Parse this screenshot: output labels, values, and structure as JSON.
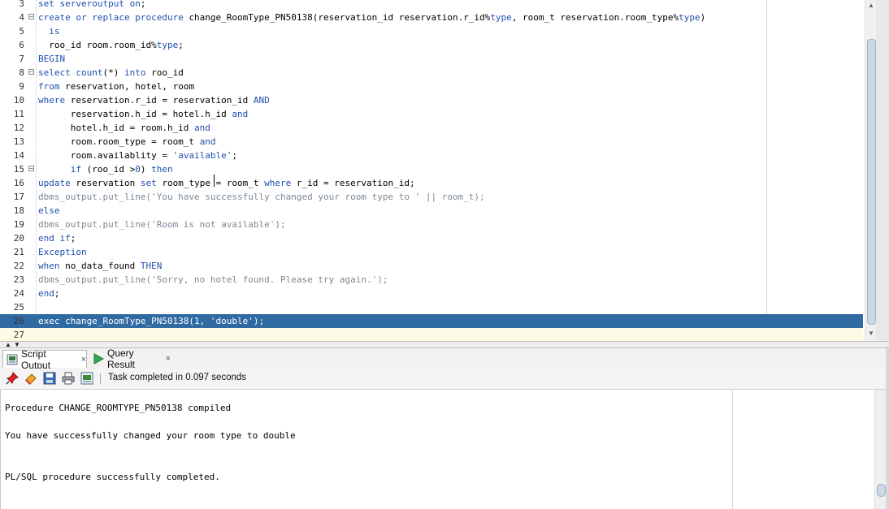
{
  "editor": {
    "lines": [
      {
        "n": "3",
        "fold": false,
        "tokens": [
          [
            "kw",
            "set serveroutput on"
          ],
          [
            "",
            "; "
          ]
        ]
      },
      {
        "n": "4",
        "fold": true,
        "tokens": [
          [
            "kw",
            "create or replace procedure "
          ],
          [
            "",
            "change_RoomType_PN50138(reservation_id reservation.r_id%"
          ],
          [
            "kw",
            "type"
          ],
          [
            "",
            ", room_t reservation.room_type%"
          ],
          [
            "kw",
            "type"
          ],
          [
            "",
            ")"
          ]
        ]
      },
      {
        "n": "5",
        "fold": false,
        "tokens": [
          [
            "kw",
            "  is"
          ]
        ]
      },
      {
        "n": "6",
        "fold": false,
        "tokens": [
          [
            "",
            "  roo_id room.room_id%"
          ],
          [
            "kw",
            "type"
          ],
          [
            "",
            ";"
          ]
        ]
      },
      {
        "n": "7",
        "fold": false,
        "tokens": [
          [
            "kw",
            "BEGIN"
          ]
        ]
      },
      {
        "n": "8",
        "fold": true,
        "tokens": [
          [
            "kw",
            "select "
          ],
          [
            "kw",
            "count"
          ],
          [
            "",
            "(*) "
          ],
          [
            "kw",
            "into"
          ],
          [
            "",
            " roo_id"
          ]
        ]
      },
      {
        "n": "9",
        "fold": false,
        "tokens": [
          [
            "kw",
            "from"
          ],
          [
            "",
            " reservation, hotel, room"
          ]
        ]
      },
      {
        "n": "10",
        "fold": false,
        "tokens": [
          [
            "kw",
            "where"
          ],
          [
            "",
            " reservation.r_id = reservation_id "
          ],
          [
            "kw",
            "AND"
          ]
        ]
      },
      {
        "n": "11",
        "fold": false,
        "tokens": [
          [
            "",
            "      reservation.h_id = hotel.h_id "
          ],
          [
            "kw",
            "and"
          ]
        ]
      },
      {
        "n": "12",
        "fold": false,
        "tokens": [
          [
            "",
            "      hotel.h_id = room.h_id "
          ],
          [
            "kw",
            "and"
          ]
        ]
      },
      {
        "n": "13",
        "fold": false,
        "tokens": [
          [
            "",
            "      room.room_type = room_t "
          ],
          [
            "kw",
            "and"
          ]
        ]
      },
      {
        "n": "14",
        "fold": false,
        "tokens": [
          [
            "",
            "      room.availablity = "
          ],
          [
            "str",
            "'available'"
          ],
          [
            "",
            ";"
          ]
        ]
      },
      {
        "n": "15",
        "fold": true,
        "tokens": [
          [
            "",
            "      "
          ],
          [
            "kw",
            "if"
          ],
          [
            "",
            " (roo_id >"
          ],
          [
            "str",
            "0"
          ],
          [
            "",
            ") "
          ],
          [
            "kw",
            "then"
          ]
        ]
      },
      {
        "n": "16",
        "fold": false,
        "tokens": [
          [
            "kw",
            "update"
          ],
          [
            "",
            " reservation "
          ],
          [
            "kw",
            "set"
          ],
          [
            "",
            " room_type = room_t "
          ],
          [
            "kw",
            "where"
          ],
          [
            "",
            " r_id = reservation_id;"
          ]
        ]
      },
      {
        "n": "17",
        "fold": false,
        "tokens": [
          [
            "cm",
            "dbms_output.put_line('You have successfully changed your room type to ' || room_t);"
          ]
        ]
      },
      {
        "n": "18",
        "fold": false,
        "tokens": [
          [
            "kw",
            "else"
          ]
        ]
      },
      {
        "n": "19",
        "fold": false,
        "tokens": [
          [
            "cm",
            "dbms_output.put_line('Room is not available');"
          ]
        ]
      },
      {
        "n": "20",
        "fold": false,
        "tokens": [
          [
            "kw",
            "end if"
          ],
          [
            "",
            ";"
          ]
        ]
      },
      {
        "n": "21",
        "fold": false,
        "tokens": [
          [
            "kw",
            "Exception"
          ]
        ]
      },
      {
        "n": "22",
        "fold": false,
        "tokens": [
          [
            "kw",
            "when"
          ],
          [
            "",
            " no_data_found "
          ],
          [
            "kw",
            "THEN"
          ]
        ]
      },
      {
        "n": "23",
        "fold": false,
        "tokens": [
          [
            "cm",
            "dbms_output.put_line('Sorry, no hotel found. Please try again.');"
          ]
        ]
      },
      {
        "n": "24",
        "fold": false,
        "tokens": [
          [
            "kw",
            "end"
          ],
          [
            "",
            ";"
          ]
        ]
      },
      {
        "n": "25",
        "fold": false,
        "tokens": []
      },
      {
        "n": "26",
        "fold": false,
        "highlight": true,
        "tokens": [
          [
            "",
            "exec change_RoomType_PN50138(1, 'double');"
          ]
        ]
      },
      {
        "n": "27",
        "fold": false,
        "caret": true,
        "tokens": []
      }
    ]
  },
  "tabs": [
    {
      "label": "Script Output",
      "close": "×",
      "icon": "script-output-icon"
    },
    {
      "label": "Query Result",
      "close": "×",
      "icon": "run-icon"
    }
  ],
  "toolbar": {
    "icons": [
      "pin-icon",
      "eraser-icon",
      "save-icon",
      "print-icon",
      "save-as-icon"
    ],
    "status": "Task completed in 0.097 seconds"
  },
  "output": {
    "lines": [
      "Procedure CHANGE_ROOMTYPE_PN50138 compiled",
      "",
      "You have successfully changed your room type to double",
      "",
      "",
      "PL/SQL procedure successfully completed."
    ]
  },
  "colors": {
    "keyword": "#1f4fae",
    "comment": "#7a8894",
    "selection": "#2f6aa3"
  }
}
